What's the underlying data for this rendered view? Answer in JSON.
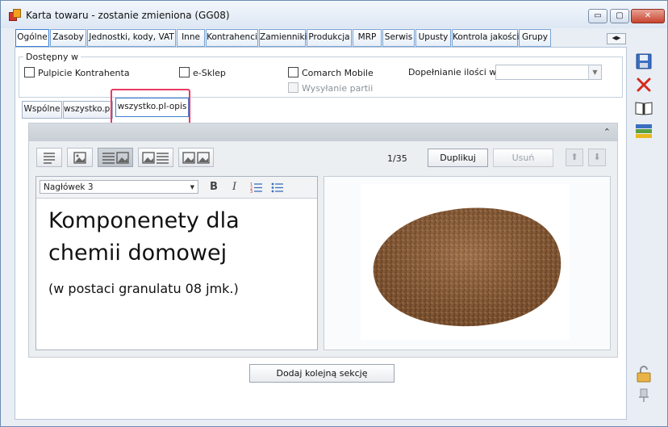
{
  "window": {
    "title": "Karta towaru - zostanie zmieniona (GG08)",
    "controls": {
      "minimize": "▭",
      "maximize": "▢",
      "close": "✕"
    }
  },
  "main_tabs": [
    {
      "label": "Ogólne"
    },
    {
      "label": "Zasoby"
    },
    {
      "label": "Jednostki, kody, VAT"
    },
    {
      "label": "Inne"
    },
    {
      "label": "Kontrahenci"
    },
    {
      "label": "Zamienniki"
    },
    {
      "label": "Produkcja"
    },
    {
      "label": "MRP"
    },
    {
      "label": "Serwis"
    },
    {
      "label": "Upusty"
    },
    {
      "label": "Kontrola jakości"
    },
    {
      "label": "Grupy"
    }
  ],
  "available": {
    "legend": "Dostępny w",
    "pulpit": "Pulpicie Kontrahenta",
    "esklep": "e-Sklep",
    "comarch_mobile": "Comarch Mobile",
    "wysylanie": "Wysyłanie partii",
    "dopelnianie_label": "Dopełnianie ilości wg:",
    "dopelnianie_value": ""
  },
  "sub_tabs": [
    {
      "label": "Wspólne"
    },
    {
      "label": "wszystko.pl"
    },
    {
      "label": "wszystko.pl-opis"
    }
  ],
  "section": {
    "collapse_icon": "⌃",
    "page_counter": "1/35",
    "duplicate_label": "Duplikuj",
    "delete_label": "Usuń",
    "move_up": "⬆",
    "move_down": "⬇"
  },
  "editor": {
    "style_select": "Nagłówek 3",
    "bold": "B",
    "italic": "I",
    "heading_text": "Komponenety dla chemii domowej",
    "paragraph_text": "(w postaci granulatu 08 jmk.)"
  },
  "add_section_label": "Dodaj kolejną sekcję",
  "colors": {
    "accent": "#3b7fd4",
    "highlight": "#e83a63",
    "save": "#3a6fc2",
    "delete": "#d42b1e"
  },
  "icons": [
    "save-icon",
    "delete-icon",
    "book-icon",
    "list-icon",
    "unlock-icon",
    "pin-icon"
  ]
}
